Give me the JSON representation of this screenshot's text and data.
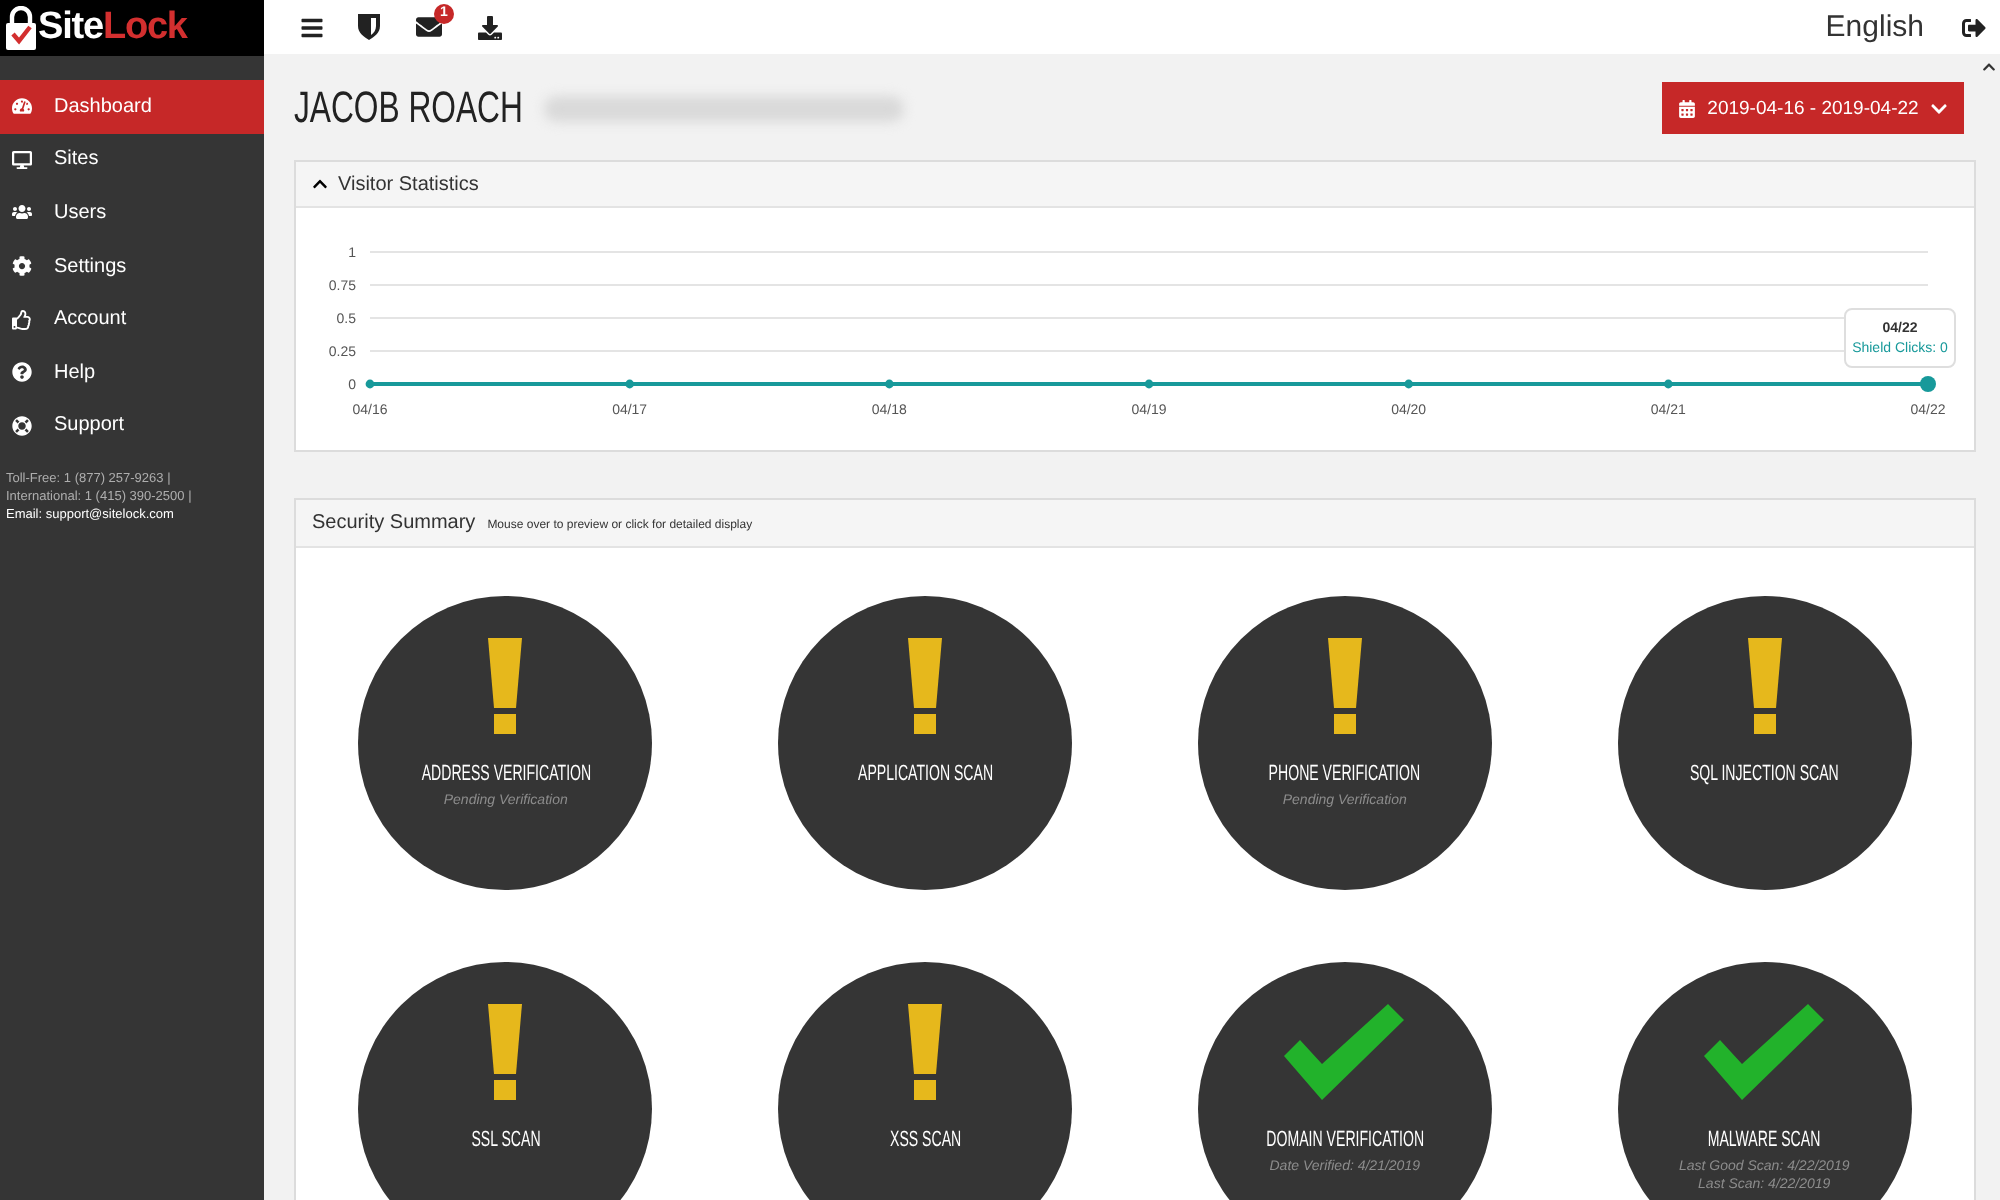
{
  "logo": {
    "part_1": "Site",
    "part_2": "Lock"
  },
  "sidebar": {
    "items": [
      {
        "label": "Dashboard",
        "selected": true
      },
      {
        "label": "Sites",
        "selected": false
      },
      {
        "label": "Users",
        "selected": false
      },
      {
        "label": "Settings",
        "selected": false
      },
      {
        "label": "Account",
        "selected": false
      },
      {
        "label": "Help",
        "selected": false
      },
      {
        "label": "Support",
        "selected": false
      }
    ],
    "contact": [
      {
        "text": "Toll-Free: 1 (877) 257-9263 |",
        "highlighted": false
      },
      {
        "text": "International: 1 (415) 390-2500 |",
        "highlighted": false
      },
      {
        "text": "Email: support@sitelock.com",
        "highlighted": true
      }
    ]
  },
  "topbar": {
    "mail_badge": "1",
    "language": "English"
  },
  "header": {
    "title": "JACOB ROACH",
    "date_range": "2019-04-16 - 2019-04-22"
  },
  "visitor_statistics": {
    "title": "Visitor Statistics",
    "expanded": true,
    "chart_data": {
      "type": "line",
      "grid": true,
      "categories": [
        "04/16",
        "04/17",
        "04/18",
        "04/19",
        "04/20",
        "04/21",
        "04/22"
      ],
      "series": [
        {
          "color": "#17999a",
          "marker": true,
          "values": [
            0,
            0,
            0,
            0,
            0,
            0,
            0
          ]
        }
      ],
      "ylim": [
        0,
        1
      ],
      "yticks": [
        0,
        0.25,
        0.5,
        0.75,
        1
      ]
    },
    "tooltip": {
      "date": "04/22",
      "text": "Shield Clicks: 0"
    }
  },
  "security_summary": {
    "title": "Security Summary",
    "hint": "Mouse over to preview or click for detailed display",
    "items": [
      {
        "kind": "warning",
        "title": "ADDRESS VERIFICATION",
        "details": [
          "Pending Verification"
        ]
      },
      {
        "kind": "warning",
        "title": "APPLICATION SCAN"
      },
      {
        "kind": "warning",
        "title": "PHONE VERIFICATION",
        "details": [
          "Pending Verification"
        ]
      },
      {
        "kind": "warning",
        "title": "SQL INJECTION SCAN"
      },
      {
        "kind": "warning",
        "title": "SSL SCAN"
      },
      {
        "kind": "warning",
        "title": "XSS SCAN"
      },
      {
        "kind": "ok",
        "title": "DOMAIN VERIFICATION",
        "details": [
          "Date Verified: 4/21/2019"
        ]
      },
      {
        "kind": "ok",
        "title": "MALWARE SCAN",
        "details": [
          "Last Good Scan: 4/22/2019",
          "Last Scan: 4/22/2019"
        ]
      }
    ]
  }
}
